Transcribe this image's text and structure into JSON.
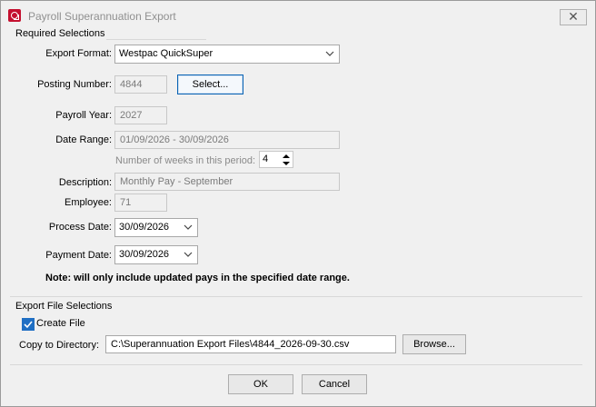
{
  "window": {
    "title": "Payroll Superannuation Export",
    "close_glyph": "✕"
  },
  "required": {
    "group_title": "Required Selections",
    "export_format": {
      "label": "Export Format:",
      "value": "Westpac QuickSuper"
    },
    "posting_number": {
      "label": "Posting Number:",
      "value": "4844",
      "select_button": "Select..."
    },
    "payroll_year": {
      "label": "Payroll Year:",
      "value": "2027"
    },
    "date_range": {
      "label": "Date Range:",
      "value": "01/09/2026 - 30/09/2026"
    },
    "weeks": {
      "label": "Number of weeks in this period:",
      "value": "4"
    },
    "description": {
      "label": "Description:",
      "value": "Monthly Pay - September"
    },
    "employee": {
      "label": "Employee:",
      "value": "71"
    },
    "process_date": {
      "label": "Process Date:",
      "value": "30/09/2026"
    },
    "payment_date": {
      "label": "Payment Date:",
      "value": "30/09/2026"
    },
    "note": "Note: will only include updated pays in the specified date range."
  },
  "export": {
    "group_title": "Export File Selections",
    "create_file": {
      "label": "Create File",
      "checked": true
    },
    "directory": {
      "label": "Copy to Directory:",
      "value": "C:\\Superannuation Export Files\\4844_2026-09-30.csv",
      "browse_button": "Browse..."
    }
  },
  "footer": {
    "ok": "OK",
    "cancel": "Cancel"
  },
  "colors": {
    "accent": "#1f6fc4",
    "brand": "#c4102f",
    "focus_border": "#0a64b4"
  }
}
